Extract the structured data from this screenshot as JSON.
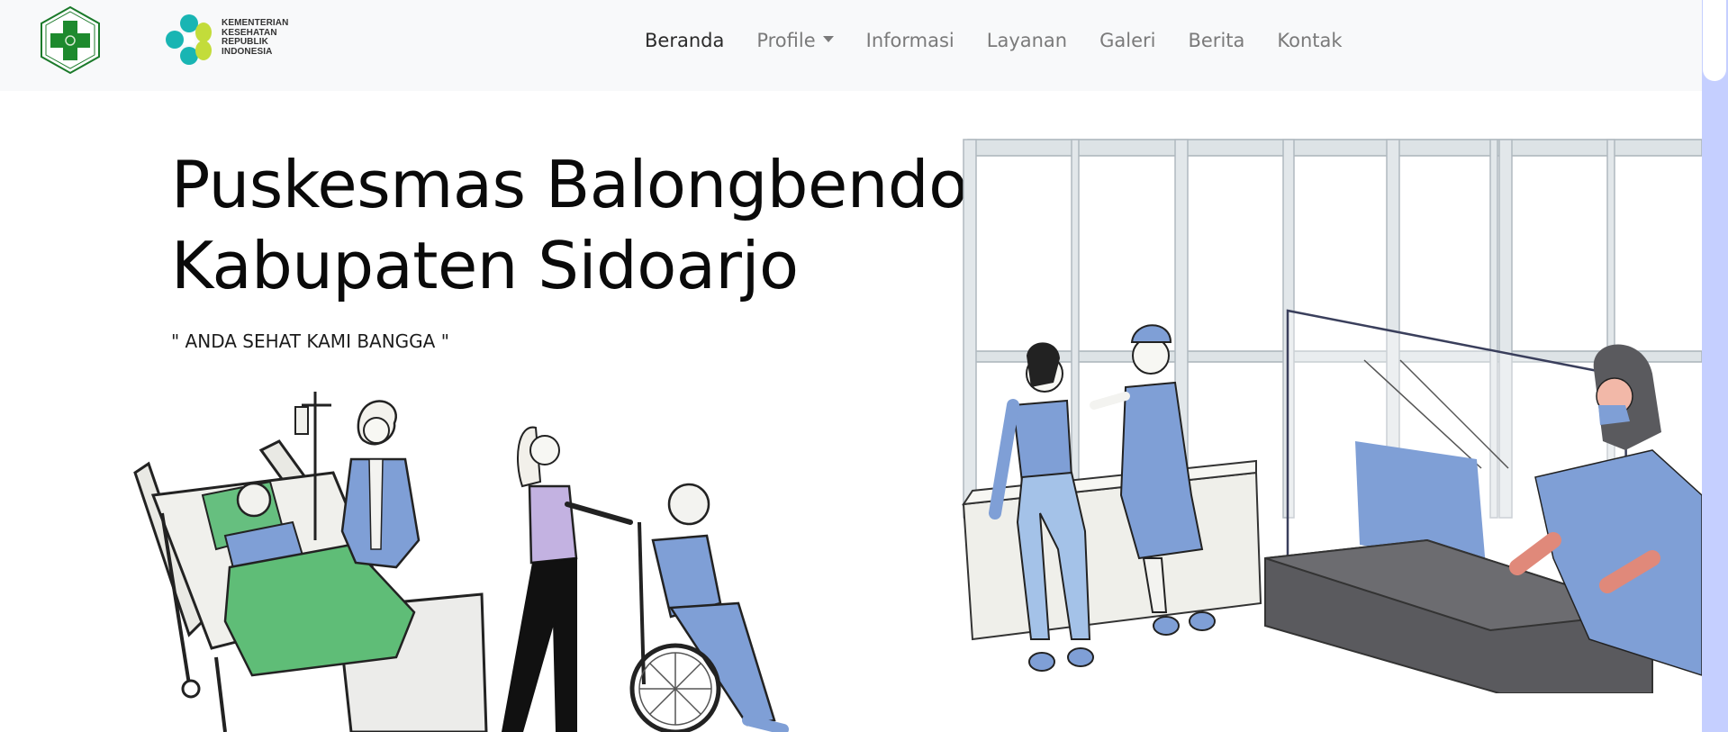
{
  "brand": {
    "kemenkes_lines": [
      "KEMENTERIAN",
      "KESEHATAN",
      "REPUBLIK",
      "INDONESIA"
    ]
  },
  "nav": {
    "items": [
      {
        "label": "Beranda",
        "active": true
      },
      {
        "label": "Profile",
        "dropdown": true
      },
      {
        "label": "Informasi"
      },
      {
        "label": "Layanan"
      },
      {
        "label": "Galeri"
      },
      {
        "label": "Berita"
      },
      {
        "label": "Kontak"
      }
    ]
  },
  "hero": {
    "title_line1": "Puskesmas Balongbendo",
    "title_line2": "Kabupaten Sidoarjo",
    "tagline": "\" ANDA SEHAT KAMI BANGGA \""
  },
  "colors": {
    "navbar_bg": "#f8f9fa",
    "accent_green": "#1e8a2e",
    "illustration_blue": "#7f9fd6",
    "scrollbar": "#c5cfff"
  },
  "icons": {
    "puskesmas_logo": "green-cross-hexagon",
    "kemenkes_logo": "flower-cross-teal-lime"
  }
}
